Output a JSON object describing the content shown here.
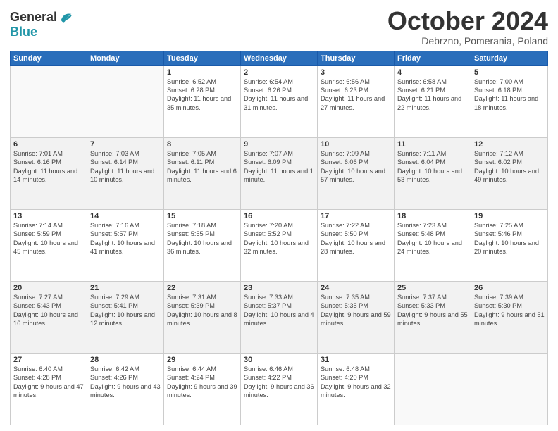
{
  "header": {
    "logo_line1": "General",
    "logo_line2": "Blue",
    "month": "October 2024",
    "location": "Debrzno, Pomerania, Poland"
  },
  "days_of_week": [
    "Sunday",
    "Monday",
    "Tuesday",
    "Wednesday",
    "Thursday",
    "Friday",
    "Saturday"
  ],
  "weeks": [
    [
      {
        "day": "",
        "info": ""
      },
      {
        "day": "",
        "info": ""
      },
      {
        "day": "1",
        "info": "Sunrise: 6:52 AM\nSunset: 6:28 PM\nDaylight: 11 hours and 35 minutes."
      },
      {
        "day": "2",
        "info": "Sunrise: 6:54 AM\nSunset: 6:26 PM\nDaylight: 11 hours and 31 minutes."
      },
      {
        "day": "3",
        "info": "Sunrise: 6:56 AM\nSunset: 6:23 PM\nDaylight: 11 hours and 27 minutes."
      },
      {
        "day": "4",
        "info": "Sunrise: 6:58 AM\nSunset: 6:21 PM\nDaylight: 11 hours and 22 minutes."
      },
      {
        "day": "5",
        "info": "Sunrise: 7:00 AM\nSunset: 6:18 PM\nDaylight: 11 hours and 18 minutes."
      }
    ],
    [
      {
        "day": "6",
        "info": "Sunrise: 7:01 AM\nSunset: 6:16 PM\nDaylight: 11 hours and 14 minutes."
      },
      {
        "day": "7",
        "info": "Sunrise: 7:03 AM\nSunset: 6:14 PM\nDaylight: 11 hours and 10 minutes."
      },
      {
        "day": "8",
        "info": "Sunrise: 7:05 AM\nSunset: 6:11 PM\nDaylight: 11 hours and 6 minutes."
      },
      {
        "day": "9",
        "info": "Sunrise: 7:07 AM\nSunset: 6:09 PM\nDaylight: 11 hours and 1 minute."
      },
      {
        "day": "10",
        "info": "Sunrise: 7:09 AM\nSunset: 6:06 PM\nDaylight: 10 hours and 57 minutes."
      },
      {
        "day": "11",
        "info": "Sunrise: 7:11 AM\nSunset: 6:04 PM\nDaylight: 10 hours and 53 minutes."
      },
      {
        "day": "12",
        "info": "Sunrise: 7:12 AM\nSunset: 6:02 PM\nDaylight: 10 hours and 49 minutes."
      }
    ],
    [
      {
        "day": "13",
        "info": "Sunrise: 7:14 AM\nSunset: 5:59 PM\nDaylight: 10 hours and 45 minutes."
      },
      {
        "day": "14",
        "info": "Sunrise: 7:16 AM\nSunset: 5:57 PM\nDaylight: 10 hours and 41 minutes."
      },
      {
        "day": "15",
        "info": "Sunrise: 7:18 AM\nSunset: 5:55 PM\nDaylight: 10 hours and 36 minutes."
      },
      {
        "day": "16",
        "info": "Sunrise: 7:20 AM\nSunset: 5:52 PM\nDaylight: 10 hours and 32 minutes."
      },
      {
        "day": "17",
        "info": "Sunrise: 7:22 AM\nSunset: 5:50 PM\nDaylight: 10 hours and 28 minutes."
      },
      {
        "day": "18",
        "info": "Sunrise: 7:23 AM\nSunset: 5:48 PM\nDaylight: 10 hours and 24 minutes."
      },
      {
        "day": "19",
        "info": "Sunrise: 7:25 AM\nSunset: 5:46 PM\nDaylight: 10 hours and 20 minutes."
      }
    ],
    [
      {
        "day": "20",
        "info": "Sunrise: 7:27 AM\nSunset: 5:43 PM\nDaylight: 10 hours and 16 minutes."
      },
      {
        "day": "21",
        "info": "Sunrise: 7:29 AM\nSunset: 5:41 PM\nDaylight: 10 hours and 12 minutes."
      },
      {
        "day": "22",
        "info": "Sunrise: 7:31 AM\nSunset: 5:39 PM\nDaylight: 10 hours and 8 minutes."
      },
      {
        "day": "23",
        "info": "Sunrise: 7:33 AM\nSunset: 5:37 PM\nDaylight: 10 hours and 4 minutes."
      },
      {
        "day": "24",
        "info": "Sunrise: 7:35 AM\nSunset: 5:35 PM\nDaylight: 9 hours and 59 minutes."
      },
      {
        "day": "25",
        "info": "Sunrise: 7:37 AM\nSunset: 5:33 PM\nDaylight: 9 hours and 55 minutes."
      },
      {
        "day": "26",
        "info": "Sunrise: 7:39 AM\nSunset: 5:30 PM\nDaylight: 9 hours and 51 minutes."
      }
    ],
    [
      {
        "day": "27",
        "info": "Sunrise: 6:40 AM\nSunset: 4:28 PM\nDaylight: 9 hours and 47 minutes."
      },
      {
        "day": "28",
        "info": "Sunrise: 6:42 AM\nSunset: 4:26 PM\nDaylight: 9 hours and 43 minutes."
      },
      {
        "day": "29",
        "info": "Sunrise: 6:44 AM\nSunset: 4:24 PM\nDaylight: 9 hours and 39 minutes."
      },
      {
        "day": "30",
        "info": "Sunrise: 6:46 AM\nSunset: 4:22 PM\nDaylight: 9 hours and 36 minutes."
      },
      {
        "day": "31",
        "info": "Sunrise: 6:48 AM\nSunset: 4:20 PM\nDaylight: 9 hours and 32 minutes."
      },
      {
        "day": "",
        "info": ""
      },
      {
        "day": "",
        "info": ""
      }
    ]
  ]
}
